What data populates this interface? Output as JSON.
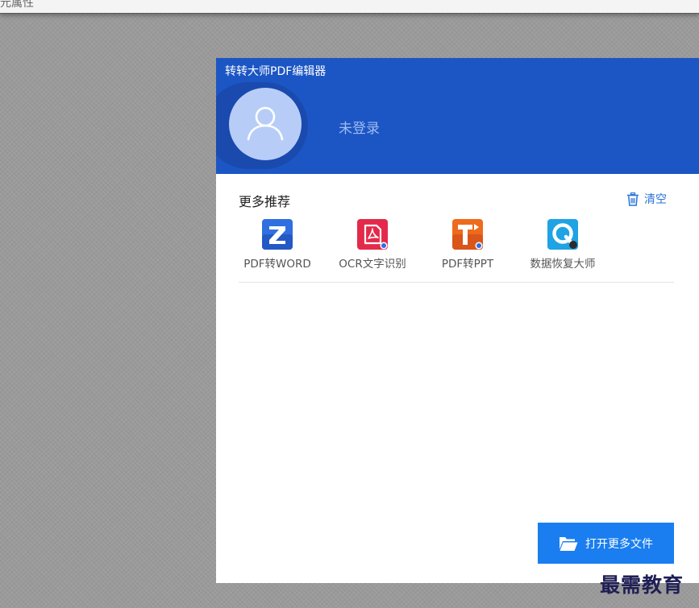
{
  "window": {
    "top_fragment": "元属性"
  },
  "panel": {
    "app_title": "转转大师PDF编辑器",
    "login_status": "未登录",
    "section_title": "更多推荐",
    "clear_label": "清空",
    "recommendations": [
      {
        "label": "PDF转WORD",
        "icon": "z-logo-icon",
        "color": "#2f6fe0"
      },
      {
        "label": "OCR文字识别",
        "icon": "pdf-acrobat-icon",
        "color": "#e32a4a"
      },
      {
        "label": "PDF转PPT",
        "icon": "t-logo-icon",
        "color": "#ee6a1c"
      },
      {
        "label": "数据恢复大师",
        "icon": "q-logo-icon",
        "color": "#1fa3e4"
      }
    ],
    "open_more_label": "打开更多文件"
  },
  "watermark": "最需教育",
  "colors": {
    "header_bg": "#1c56c4",
    "accent_blue": "#1a7ef0",
    "link_blue": "#2a73d9"
  }
}
